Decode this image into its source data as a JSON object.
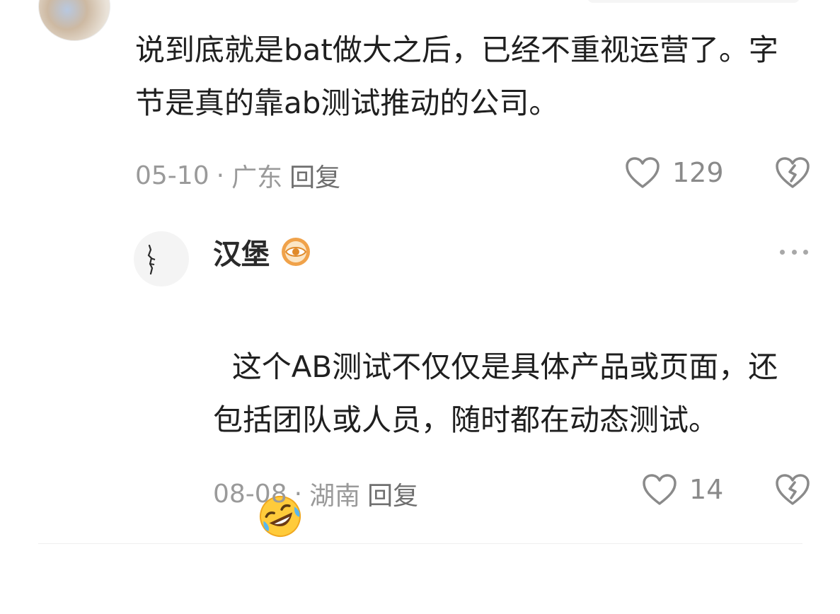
{
  "comment_1": {
    "text": "说到底就是bat做大之后，已经不重视运营了。字节是真的靠ab测试推动的公司。",
    "date": "05-10",
    "separator": "·",
    "location": "广东",
    "reply_label": "回复",
    "like_count": "129",
    "like_icon": "heart-outline",
    "dislike_icon": "broken-heart"
  },
  "comment_2": {
    "username": "汉堡",
    "badge_icon": "eye-badge",
    "text": "这个AB测试不仅仅是具体产品或页面，还包括团队或人员，随时都在动态测试。",
    "emoji": "laughing-crying-face",
    "date": "08-08",
    "separator": "·",
    "location": "湖南",
    "reply_label": "回复",
    "like_count": "14",
    "like_icon": "heart-outline",
    "dislike_icon": "broken-heart",
    "more_icon": "more-dots"
  },
  "colors": {
    "text": "#1f1f1f",
    "meta": "#9a9a9a",
    "icon": "#8a8a8a",
    "badge": "#f0a24a"
  }
}
